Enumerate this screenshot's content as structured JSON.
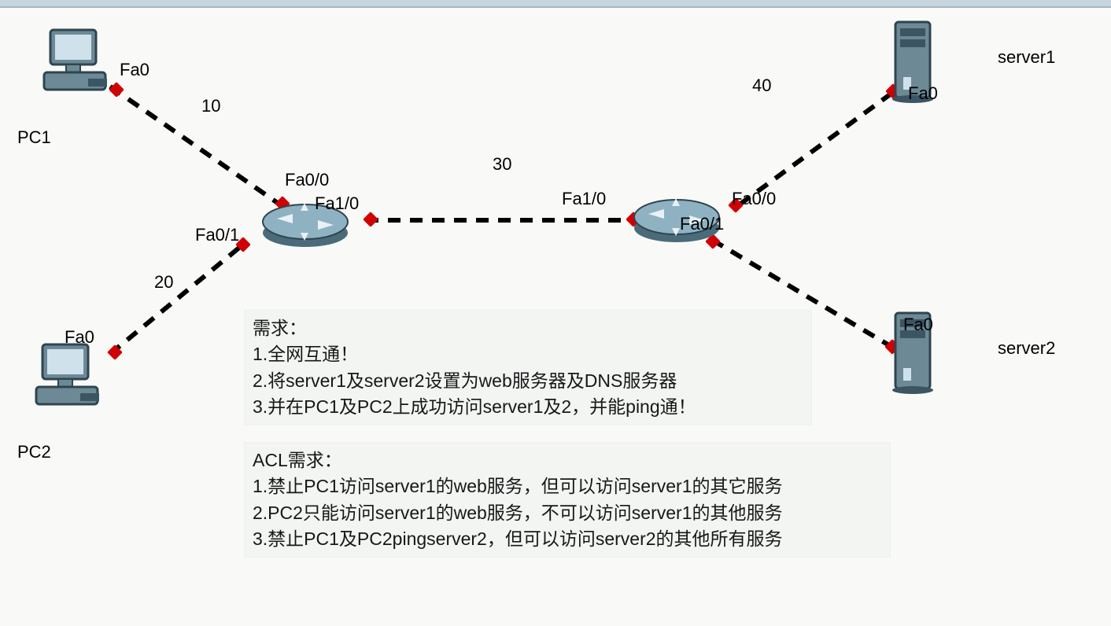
{
  "devices": {
    "pc1": {
      "label": "PC1",
      "if": "Fa0"
    },
    "pc2": {
      "label": "PC2",
      "if": "Fa0"
    },
    "server1": {
      "label": "server1",
      "if": "Fa0"
    },
    "server2": {
      "label": "server2",
      "if": "Fa0"
    },
    "router1": {
      "ifs": {
        "fa00": "Fa0/0",
        "fa01": "Fa0/1",
        "fa10": "Fa1/0"
      }
    },
    "router2": {
      "ifs": {
        "fa00": "Fa0/0",
        "fa01": "Fa0/1",
        "fa10": "Fa1/0"
      }
    }
  },
  "links": {
    "pc1_r1": "10",
    "pc2_r1": "20",
    "r1_r2": "30",
    "r2_s1": "40"
  },
  "notes": {
    "req_title": "需求：",
    "req1": "1.全网互通！",
    "req2": "2.将server1及server2设置为web服务器及DNS服务器",
    "req3": "3.并在PC1及PC2上成功访问server1及2，并能ping通！",
    "acl_title": "ACL需求：",
    "acl1": "1.禁止PC1访问server1的web服务，但可以访问server1的其它服务",
    "acl2": "2.PC2只能访问server1的web服务，不可以访问server1的其他服务",
    "acl3": "3.禁止PC1及PC2pingserver2，但可以访问server2的其他所有服务"
  },
  "chart_data": {
    "type": "diagram",
    "title": "Network Topology with ACL Requirements",
    "nodes": [
      {
        "id": "PC1",
        "type": "pc",
        "interfaces": [
          "Fa0"
        ]
      },
      {
        "id": "PC2",
        "type": "pc",
        "interfaces": [
          "Fa0"
        ]
      },
      {
        "id": "R1",
        "type": "router",
        "interfaces": [
          "Fa0/0",
          "Fa0/1",
          "Fa1/0"
        ]
      },
      {
        "id": "R2",
        "type": "router",
        "interfaces": [
          "Fa0/0",
          "Fa0/1",
          "Fa1/0"
        ]
      },
      {
        "id": "server1",
        "type": "server",
        "interfaces": [
          "Fa0"
        ]
      },
      {
        "id": "server2",
        "type": "server",
        "interfaces": [
          "Fa0"
        ]
      }
    ],
    "edges": [
      {
        "from": "PC1",
        "from_if": "Fa0",
        "to": "R1",
        "to_if": "Fa0/0",
        "label": "10"
      },
      {
        "from": "PC2",
        "from_if": "Fa0",
        "to": "R1",
        "to_if": "Fa0/1",
        "label": "20"
      },
      {
        "from": "R1",
        "from_if": "Fa1/0",
        "to": "R2",
        "to_if": "Fa1/0",
        "label": "30"
      },
      {
        "from": "R2",
        "from_if": "Fa0/0",
        "to": "server1",
        "to_if": "Fa0",
        "label": "40"
      },
      {
        "from": "R2",
        "from_if": "Fa0/1",
        "to": "server2",
        "to_if": "Fa0",
        "label": ""
      }
    ],
    "requirements": [
      "全网互通！",
      "将server1及server2设置为web服务器及DNS服务器",
      "并在PC1及PC2上成功访问server1及2，并能ping通！"
    ],
    "acl_requirements": [
      "禁止PC1访问server1的web服务，但可以访问server1的其它服务",
      "PC2只能访问server1的web服务，不可以访问server1的其他服务",
      "禁止PC1及PC2pingserver2，但可以访问server2的其他所有服务"
    ]
  }
}
